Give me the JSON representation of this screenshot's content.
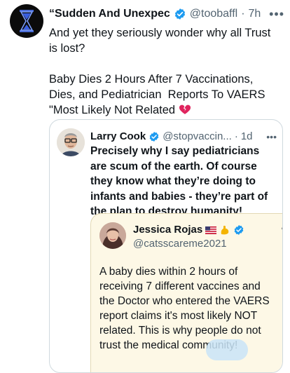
{
  "tweet": {
    "display_name": "“Sudden And Unexpec",
    "handle": "@toobaffl",
    "separator": "·",
    "time": "7h",
    "more": "•••",
    "text_line1": "And yet they seriously wonder why all Trust is lost?",
    "text_line2": "Baby Dies 2 Hours After 7 Vaccinations, Dies, and Pediatrician  Reports To VAERS \"Most Likely Not Related"
  },
  "quote": {
    "display_name": "Larry Cook",
    "handle": "@stopvaccin...",
    "separator": "·",
    "time": "1d",
    "more": "•••",
    "text": "Precisely why I say pediatricians are scum of the earth. Of course they know what they’re doing to infants and babies - they’re part of the plan to destroy humanity!"
  },
  "nested_quote": {
    "display_name": "Jessica Rojas",
    "handle": "@catsscareme2021",
    "more": "•••",
    "text": "A baby dies within 2 hours of receiving 7 different vaccines and the Doctor who entered the VAERS report claims it's most likely NOT related. This is why people do not trust the medical community!"
  },
  "icons": {
    "verified": "verified-badge-icon",
    "heart": "broken-heart-icon",
    "flag": "us-flag-icon",
    "muscle": "flexed-biceps-icon"
  },
  "colors": {
    "verified_blue": "#1d9bf0",
    "secondary_text": "#536471",
    "border": "#cfd9de",
    "nested_bg": "#fdf8e6",
    "broken_heart": "#e0245e"
  }
}
